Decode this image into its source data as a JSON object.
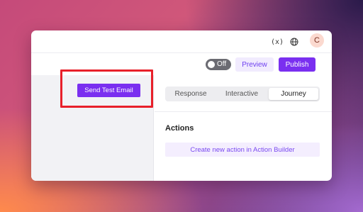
{
  "topbar": {
    "variables_icon_glyph": "(x)",
    "globe_icon_glyph": "🌐",
    "avatar_initial": "C"
  },
  "toolbar": {
    "toggle_label": "Off",
    "preview_label": "Preview",
    "publish_label": "Publish"
  },
  "left_panel": {
    "send_test_email_label": "Send Test Email"
  },
  "tabs": [
    {
      "label": "Response",
      "active": false
    },
    {
      "label": "Interactive",
      "active": false
    },
    {
      "label": "Journey",
      "active": true
    }
  ],
  "actions": {
    "title": "Actions",
    "create_label": "Create new action in Action Builder"
  },
  "colors": {
    "accent": "#7a2ff0",
    "highlight": "#e8202a"
  }
}
